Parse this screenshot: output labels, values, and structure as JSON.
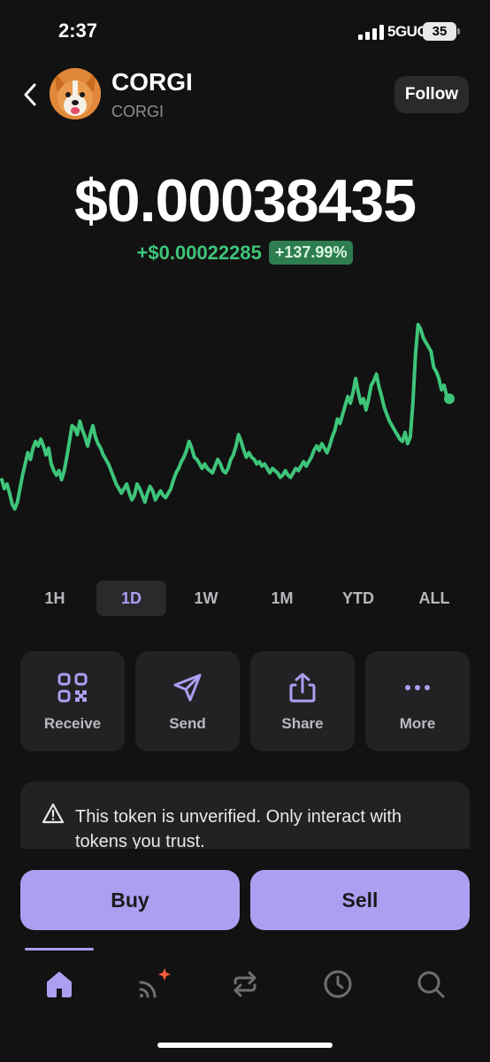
{
  "status_bar": {
    "time": "2:37",
    "network": "5GUC",
    "battery": "35",
    "icons": [
      "signal-icon",
      "battery-icon"
    ]
  },
  "header": {
    "back_icon": "chevron-left-icon",
    "avatar": "corgi-avatar",
    "token_name": "CORGI",
    "token_symbol": "CORGI",
    "follow_label": "Follow"
  },
  "price": {
    "value": "$0.00038435",
    "change_abs": "+$0.00022285",
    "change_pct": "+137.99%"
  },
  "chart": {
    "line_color": "#3ec57a",
    "series": [
      0.26,
      0.22,
      0.24,
      0.2,
      0.15,
      0.13,
      0.16,
      0.22,
      0.28,
      0.33,
      0.38,
      0.35,
      0.4,
      0.43,
      0.41,
      0.44,
      0.41,
      0.37,
      0.4,
      0.33,
      0.3,
      0.28,
      0.3,
      0.26,
      0.3,
      0.36,
      0.43,
      0.5,
      0.49,
      0.46,
      0.52,
      0.48,
      0.45,
      0.41,
      0.46,
      0.5,
      0.45,
      0.42,
      0.4,
      0.37,
      0.35,
      0.33,
      0.3,
      0.27,
      0.24,
      0.22,
      0.2,
      0.22,
      0.24,
      0.2,
      0.17,
      0.19,
      0.24,
      0.22,
      0.19,
      0.16,
      0.2,
      0.23,
      0.21,
      0.17,
      0.19,
      0.21,
      0.19,
      0.18,
      0.2,
      0.22,
      0.26,
      0.29,
      0.31,
      0.34,
      0.36,
      0.39,
      0.43,
      0.4,
      0.36,
      0.35,
      0.33,
      0.31,
      0.33,
      0.31,
      0.3,
      0.29,
      0.32,
      0.35,
      0.33,
      0.3,
      0.29,
      0.31,
      0.35,
      0.37,
      0.41,
      0.46,
      0.43,
      0.39,
      0.36,
      0.38,
      0.36,
      0.35,
      0.33,
      0.34,
      0.32,
      0.33,
      0.31,
      0.29,
      0.31,
      0.3,
      0.29,
      0.27,
      0.28,
      0.3,
      0.28,
      0.27,
      0.29,
      0.31,
      0.3,
      0.32,
      0.34,
      0.32,
      0.34,
      0.36,
      0.39,
      0.41,
      0.39,
      0.42,
      0.4,
      0.38,
      0.41,
      0.45,
      0.48,
      0.53,
      0.51,
      0.55,
      0.59,
      0.63,
      0.6,
      0.65,
      0.71,
      0.65,
      0.6,
      0.62,
      0.57,
      0.62,
      0.68,
      0.7,
      0.73,
      0.67,
      0.63,
      0.58,
      0.55,
      0.52,
      0.5,
      0.48,
      0.46,
      0.44,
      0.43,
      0.47,
      0.42,
      0.45,
      0.6,
      0.82,
      0.95,
      0.93,
      0.89,
      0.87,
      0.85,
      0.83,
      0.76,
      0.74,
      0.71,
      0.66,
      0.68,
      0.63,
      0.62
    ],
    "last_point_marker": true
  },
  "timeframes": {
    "items": [
      "1H",
      "1D",
      "1W",
      "1M",
      "YTD",
      "ALL"
    ],
    "active": "1D"
  },
  "actions": {
    "receive": "Receive",
    "send": "Send",
    "share": "Share",
    "more": "More",
    "icon_color": "#ab9ff2"
  },
  "warning": {
    "text": "This token is unverified. Only interact with tokens you trust."
  },
  "trade": {
    "buy": "Buy",
    "sell": "Sell",
    "accent": "#ab9ff2"
  },
  "nav": {
    "items": [
      "home-icon",
      "feed-icon",
      "swap-icon",
      "history-icon",
      "search-icon"
    ],
    "active": "home-icon",
    "notification_color": "#ff5a36"
  }
}
